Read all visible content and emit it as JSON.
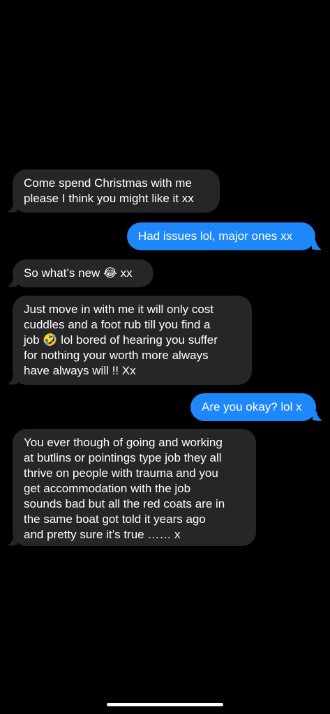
{
  "colors": {
    "background": "#000000",
    "incoming_bubble": "#262628",
    "outgoing_bubble": "#1e88fa",
    "text": "#ffffff"
  },
  "messages": [
    {
      "direction": "incoming",
      "text": "Come spend Christmas with me\nplease I think you might like it xx"
    },
    {
      "direction": "outgoing",
      "text": "Had issues lol, major ones xx"
    },
    {
      "direction": "incoming",
      "text": "So what’s new 😂 xx"
    },
    {
      "direction": "incoming",
      "text": "Just move in with me it will only cost\ncuddles and a foot rub till you find a\njob 🤣 lol bored of hearing you suffer\nfor nothing your worth more always\nhave always will !! Xx"
    },
    {
      "direction": "outgoing",
      "text": "Are you okay? lol x"
    },
    {
      "direction": "incoming",
      "text": "You ever though of going and working\nat butlins or pointings type job they all\nthrive on people with trauma and you\nget accommodation with the job\nsounds bad but all the red coats are in\nthe same boat got told it years ago\nand pretty sure it’s true …… x"
    }
  ]
}
